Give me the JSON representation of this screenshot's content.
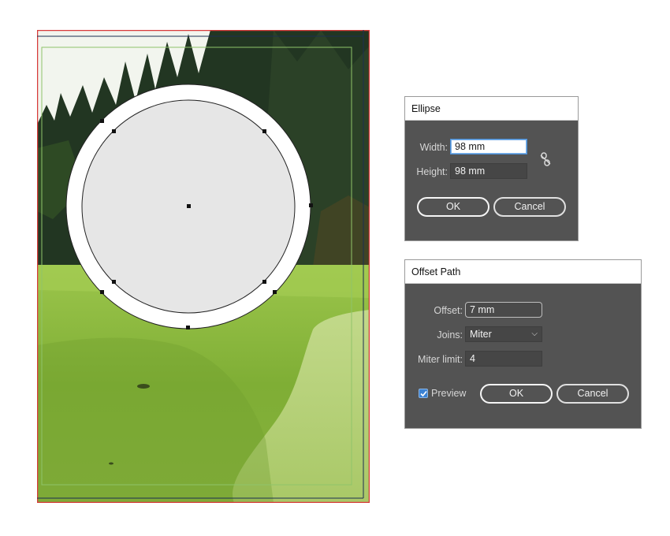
{
  "artboard": {
    "scene": "golf-course-photo",
    "colors": {
      "sky": "#f4f6f0",
      "trees": "#1f3320",
      "grass": "#86b23e",
      "fairway": "#b4cf74",
      "bleed": "#d83a3a",
      "margin": "#8fc46a",
      "shape_fill": "#e6e6e6",
      "offset_fill": "#ffffff"
    }
  },
  "ellipse_dialog": {
    "title": "Ellipse",
    "width_label": "Width:",
    "width_value": "98 mm",
    "height_label": "Height:",
    "height_value": "98 mm",
    "constrain_icon": "broken-link-icon",
    "ok_label": "OK",
    "cancel_label": "Cancel"
  },
  "offset_dialog": {
    "title": "Offset Path",
    "offset_label": "Offset:",
    "offset_value": "7 mm",
    "joins_label": "Joins:",
    "joins_value": "Miter",
    "miter_label": "Miter limit:",
    "miter_value": "4",
    "preview_label": "Preview",
    "preview_checked": true,
    "ok_label": "OK",
    "cancel_label": "Cancel"
  }
}
